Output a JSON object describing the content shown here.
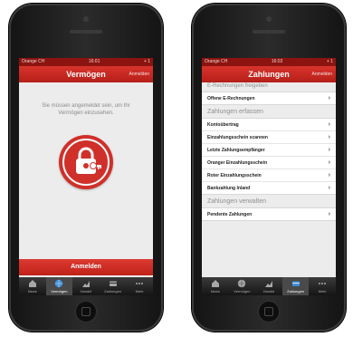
{
  "left_phone": {
    "status": {
      "carrier": "Orange CH",
      "time": "16:01",
      "battery": "+ 1"
    },
    "nav": {
      "title": "Vermögen",
      "action": "Anmelden"
    },
    "message": "Sie müssen angemeldet sein, um Ihr Vermögen einzusehen.",
    "lock_icon": "lock-key-icon",
    "login_button": "Anmelden"
  },
  "right_phone": {
    "status": {
      "carrier": "Orange CH",
      "time": "16:02",
      "battery": "+ 1"
    },
    "nav": {
      "title": "Zahlungen",
      "action": "Anmelden"
    },
    "top_section": "E-Rechnungen freigeben",
    "group1": [
      "Offene E-Rechnungen"
    ],
    "section2": "Zahlungen erfassen",
    "group2": [
      "Kontoübertrag",
      "Einzahlungsschein scannen",
      "Letzte Zahlungsempfänger",
      "Oranger Einzahlungsschein",
      "Roter Einzahlungsschein",
      "Bankzahlung Inland"
    ],
    "section3": "Zahlungen verwalten",
    "group3": [
      "Pendente Zahlungen"
    ]
  },
  "tabs": [
    {
      "label": "News",
      "icon": "home-icon"
    },
    {
      "label": "Vermögen",
      "icon": "globe-icon"
    },
    {
      "label": "Handel",
      "icon": "chart-icon"
    },
    {
      "label": "Zahlungen",
      "icon": "card-icon"
    },
    {
      "label": "Mehr",
      "icon": "more-icon"
    }
  ],
  "colors": {
    "brand_red": "#c9261e",
    "status_red": "#8b1410",
    "tabbar": "#1e1e1e"
  }
}
